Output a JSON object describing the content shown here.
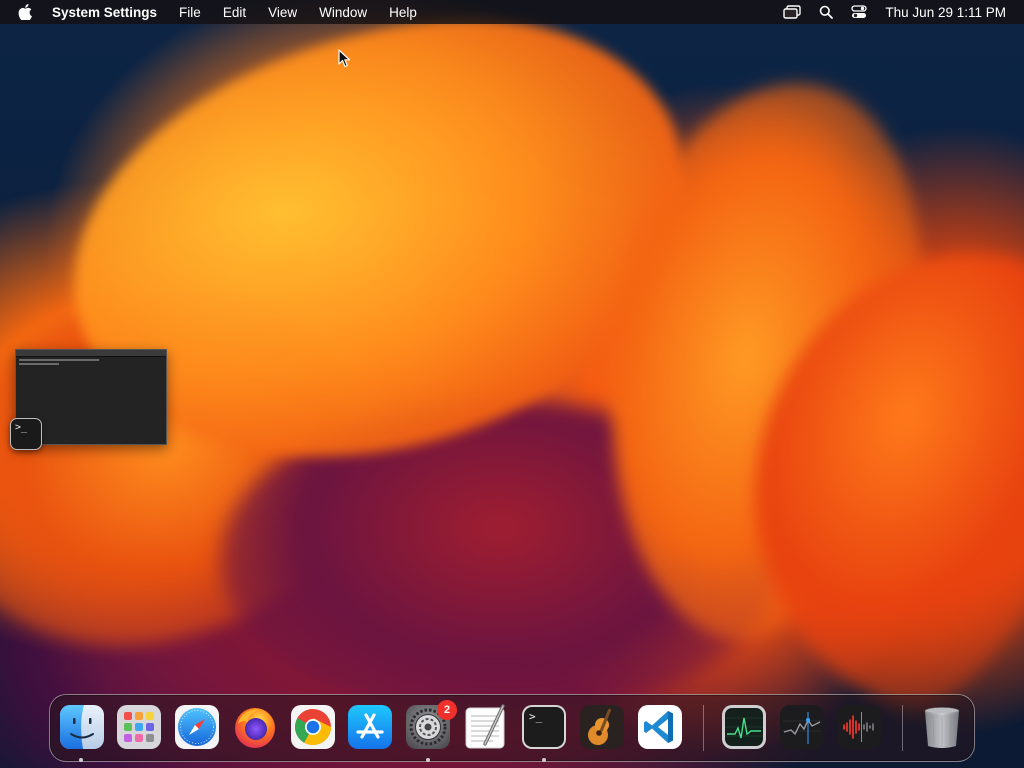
{
  "menubar": {
    "app_name": "System Settings",
    "menus": [
      "File",
      "Edit",
      "View",
      "Window",
      "Help"
    ],
    "clock": "Thu Jun 29  1:11 PM"
  },
  "terminal_preview": {
    "prompt": ">_"
  },
  "dock": {
    "apps": [
      {
        "name": "Finder",
        "icon": "finder-icon",
        "running": true
      },
      {
        "name": "Launchpad",
        "icon": "launchpad-icon",
        "running": false
      },
      {
        "name": "Safari",
        "icon": "safari-icon",
        "running": false
      },
      {
        "name": "Firefox",
        "icon": "firefox-icon",
        "running": false
      },
      {
        "name": "Google Chrome",
        "icon": "chrome-icon",
        "running": false
      },
      {
        "name": "App Store",
        "icon": "app-store-icon",
        "running": false
      },
      {
        "name": "System Settings",
        "icon": "system-settings-icon",
        "running": true,
        "badge": "2"
      },
      {
        "name": "TextEdit",
        "icon": "textedit-icon",
        "running": false
      },
      {
        "name": "Terminal",
        "icon": "terminal-icon",
        "running": true
      },
      {
        "name": "GarageBand",
        "icon": "garageband-icon",
        "running": false
      },
      {
        "name": "Visual Studio Code",
        "icon": "vscode-icon",
        "running": false
      },
      {
        "name": "Activity Monitor",
        "icon": "activity-monitor-icon",
        "running": false
      },
      {
        "name": "Stocks",
        "icon": "stocks-icon",
        "running": false
      },
      {
        "name": "Voice Memos",
        "icon": "voice-memos-icon",
        "running": false
      },
      {
        "name": "Trash",
        "icon": "trash-icon",
        "running": false
      }
    ],
    "terminal_prompt": ">_",
    "settings_badge": "2"
  },
  "colors": {
    "menubar_bg": "#141012",
    "badge_red": "#f0302a",
    "vscode_blue": "#1f8ad2",
    "chrome_red": "#ea4335",
    "chrome_yellow": "#fbbc05",
    "chrome_green": "#34a853"
  }
}
